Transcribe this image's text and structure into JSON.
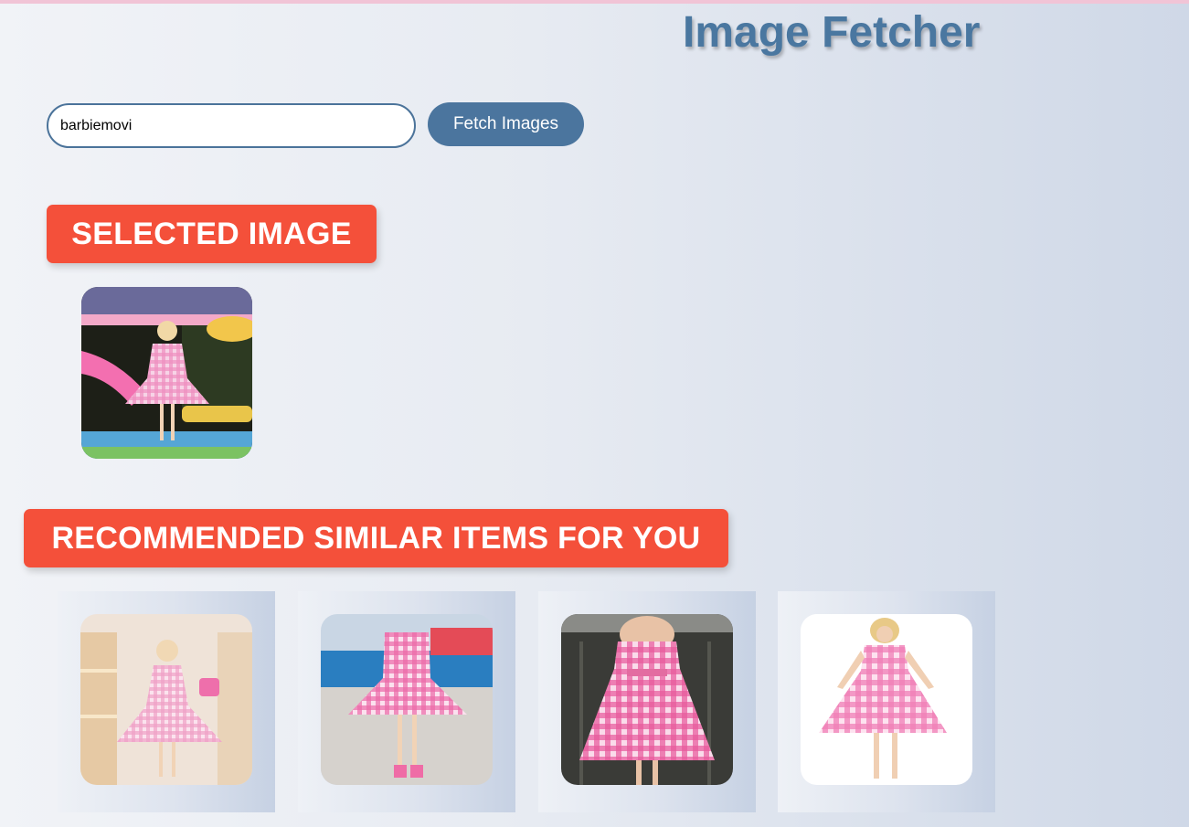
{
  "app": {
    "title": "Image Fetcher"
  },
  "search": {
    "value": "barbiemovi",
    "button_label": "Fetch Images"
  },
  "sections": {
    "selected_heading": "SELECTED IMAGE",
    "recommended_heading": "RECOMMENDED SIMILAR ITEMS FOR YOU"
  },
  "colors": {
    "title": "#4a77a0",
    "button": "#4b759e",
    "section_header": "#f4503a",
    "gingham_pink": "#f29ac7"
  },
  "recommended_count": 4
}
